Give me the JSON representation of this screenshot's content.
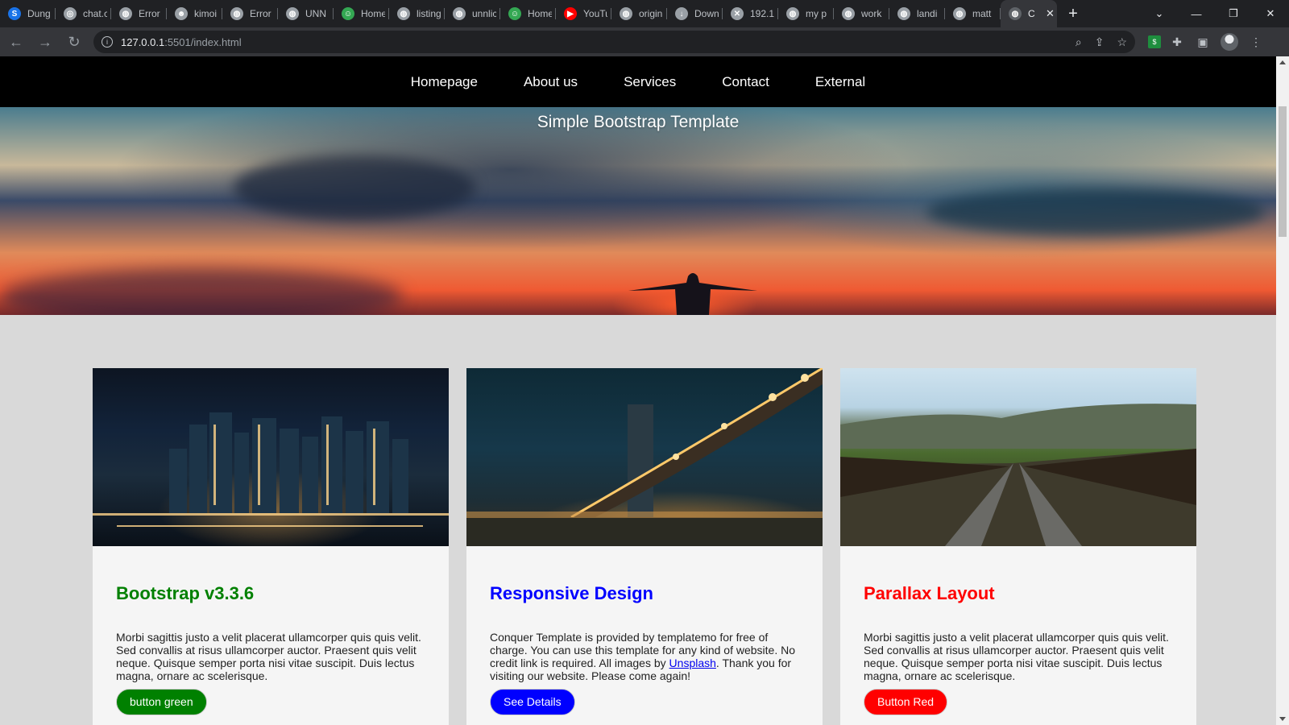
{
  "browser": {
    "tabs": [
      {
        "title": "Dung",
        "icon": "s-letter-icon",
        "color": "#1a73e8"
      },
      {
        "title": "chat.c",
        "icon": "chat-icon",
        "color": "#9aa0a6"
      },
      {
        "title": "Error",
        "icon": "globe-icon",
        "color": "#9aa0a6"
      },
      {
        "title": "kimoi",
        "icon": "user-icon",
        "color": "#9aa0a6"
      },
      {
        "title": "Error",
        "icon": "globe-icon",
        "color": "#9aa0a6"
      },
      {
        "title": "UNN",
        "icon": "globe-icon",
        "color": "#9aa0a6"
      },
      {
        "title": "Home",
        "icon": "face-icon",
        "color": "#34a853"
      },
      {
        "title": "listing",
        "icon": "globe-icon",
        "color": "#9aa0a6"
      },
      {
        "title": "unnlic",
        "icon": "globe-icon",
        "color": "#9aa0a6"
      },
      {
        "title": "Home",
        "icon": "face-icon",
        "color": "#34a853"
      },
      {
        "title": "YouTu",
        "icon": "youtube-icon",
        "color": "#ff0000"
      },
      {
        "title": "origin",
        "icon": "globe-icon",
        "color": "#9aa0a6"
      },
      {
        "title": "Down",
        "icon": "download-icon",
        "color": "#9aa0a6"
      },
      {
        "title": "192.1",
        "icon": "x-logo-icon",
        "color": "#9aa0a6"
      },
      {
        "title": "my p",
        "icon": "globe-icon",
        "color": "#9aa0a6"
      },
      {
        "title": "work",
        "icon": "globe-icon",
        "color": "#9aa0a6"
      },
      {
        "title": "landi",
        "icon": "globe-icon",
        "color": "#9aa0a6"
      },
      {
        "title": "matt",
        "icon": "globe-icon",
        "color": "#9aa0a6"
      }
    ],
    "active_tab": {
      "title": "C",
      "icon": "globe-icon"
    },
    "url_host": "127.0.0.1",
    "url_path": ":5501/index.html"
  },
  "nav": {
    "items": [
      "Homepage",
      "About us",
      "Services",
      "Contact",
      "External"
    ]
  },
  "hero": {
    "title": "Simple Bootstrap Template"
  },
  "cards": [
    {
      "title": "Bootstrap v3.3.6",
      "title_color": "#008000",
      "text": "Morbi sagittis justo a velit placerat ullamcorper quis quis velit. Sed convallis at risus ullamcorper auctor. Praesent quis velit neque. Quisque semper porta nisi vitae suscipit. Duis lectus magna, ornare ac scelerisque.",
      "button": "button green",
      "button_color": "#008000"
    },
    {
      "title": "Responsive Design",
      "title_color": "#0000ff",
      "text_before": "Conquer Template is provided by templatemo for free of charge. You can use this template for any kind of website. No credit link is required. All images by ",
      "link": "Unsplash",
      "text_after": ". Thank you for visiting our website. Please come again!",
      "button": "See Details",
      "button_color": "#0000ff"
    },
    {
      "title": "Parallax Layout",
      "title_color": "#ff0000",
      "text": "Morbi sagittis justo a velit placerat ullamcorper quis quis velit. Sed convallis at risus ullamcorper auctor. Praesent quis velit neque. Quisque semper porta nisi vitae suscipit. Duis lectus magna, ornare ac scelerisque.",
      "button": "Button Red",
      "button_color": "#ff0000"
    }
  ]
}
